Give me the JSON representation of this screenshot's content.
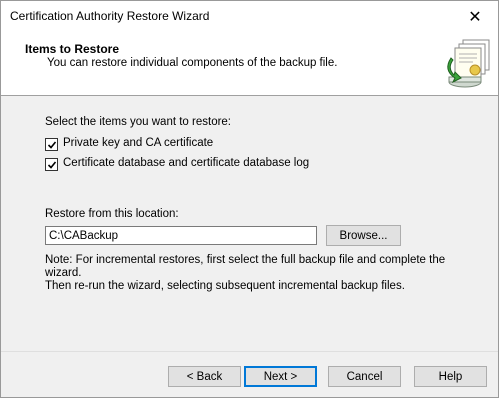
{
  "window": {
    "title": "Certification Authority Restore Wizard",
    "close_glyph": "✕"
  },
  "header": {
    "title": "Items to Restore",
    "subtitle": "You can restore individual components of the backup file.",
    "icon": "certificate-restore-icon"
  },
  "items": {
    "prompt": "Select the items you want to restore:",
    "options": [
      {
        "label": "Private key and CA certificate",
        "checked": true
      },
      {
        "label": "Certificate database and certificate database log",
        "checked": true
      }
    ]
  },
  "location": {
    "label": "Restore from this location:",
    "value": "C:\\CABackup",
    "browse_label": "Browse..."
  },
  "note": {
    "line1": "Note: For incremental restores, first select the full backup file and complete the wizard.",
    "line2": "Then re-run the wizard, selecting subsequent incremental backup files."
  },
  "buttons": {
    "back": "< Back",
    "next": "Next >",
    "cancel": "Cancel",
    "help": "Help"
  },
  "colors": {
    "focus_border": "#0078d7",
    "button_face": "#e1e1e1"
  }
}
